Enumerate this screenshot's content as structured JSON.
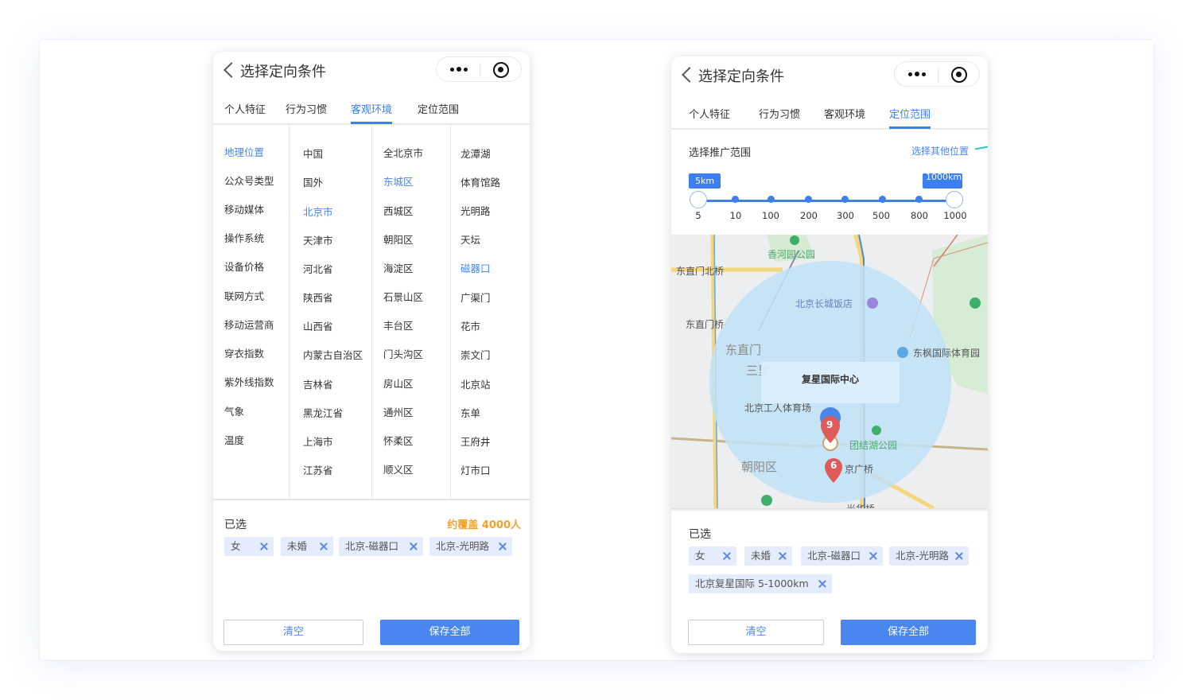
{
  "left_phone": {
    "header": {
      "title": "选择定向条件"
    },
    "tabs": [
      "个人特征",
      "行为习惯",
      "客观环境",
      "定位范围"
    ],
    "active_tab": 2,
    "col1": [
      "地理位置",
      "公众号类型",
      "移动媒体",
      "操作系统",
      "设备价格",
      "联网方式",
      "移动运营商",
      "穿衣指数",
      "紫外线指数",
      "气象",
      "温度"
    ],
    "col2": [
      "中国",
      "国外",
      "北京市",
      "天津市",
      "河北省",
      "陕西省",
      "山西省",
      "内蒙古自治区",
      "吉林省",
      "黑龙江省",
      "上海市",
      "江苏省"
    ],
    "col3": [
      "全北京市",
      "东城区",
      "西城区",
      "朝阳区",
      "海淀区",
      "石景山区",
      "丰台区",
      "门头沟区",
      "房山区",
      "通州区",
      "怀柔区",
      "顺义区"
    ],
    "col4": [
      "龙潭湖",
      "体育馆路",
      "光明路",
      "天坛",
      "磁器口",
      "广渠门",
      "花市",
      "崇文门",
      "北京站",
      "东单",
      "王府井",
      "灯市口"
    ],
    "selected": {
      "title": "已选",
      "count": "约覆盖 4000人",
      "chips": [
        "女",
        "未婚",
        "北京-磁器口",
        "北京-光明路"
      ]
    },
    "buttons": {
      "clear": "清空",
      "save": "保存全部"
    }
  },
  "right_phone": {
    "header": {
      "title": "选择定向条件"
    },
    "tabs": [
      "个人特征",
      "行为习惯",
      "客观环境",
      "定位范围"
    ],
    "active_tab": 3,
    "range": {
      "title": "选择推广范围",
      "link": "选择其他位置",
      "min_badge": "5km",
      "max_badge": "1000km",
      "ticks": [
        "5",
        "10",
        "100",
        "200",
        "300",
        "500",
        "800",
        "1000"
      ]
    },
    "map": {
      "labels": [
        "香河园公园",
        "东直门北桥",
        "北京长城饭店",
        "东直门桥",
        "东直门",
        "东枫国际体育园",
        "三里",
        "北京工人体育场",
        "团结湖公园",
        "朝阳区",
        "京广桥",
        "光华桥"
      ],
      "popup": "复星国际中心",
      "pins": [
        "9",
        "6"
      ]
    },
    "selected": {
      "title": "已选",
      "chips": [
        "女",
        "未婚",
        "北京-磁器口",
        "北京-光明路",
        "北京复星国际  5-1000km"
      ]
    },
    "buttons": {
      "clear": "清空",
      "save": "保存全部"
    }
  }
}
